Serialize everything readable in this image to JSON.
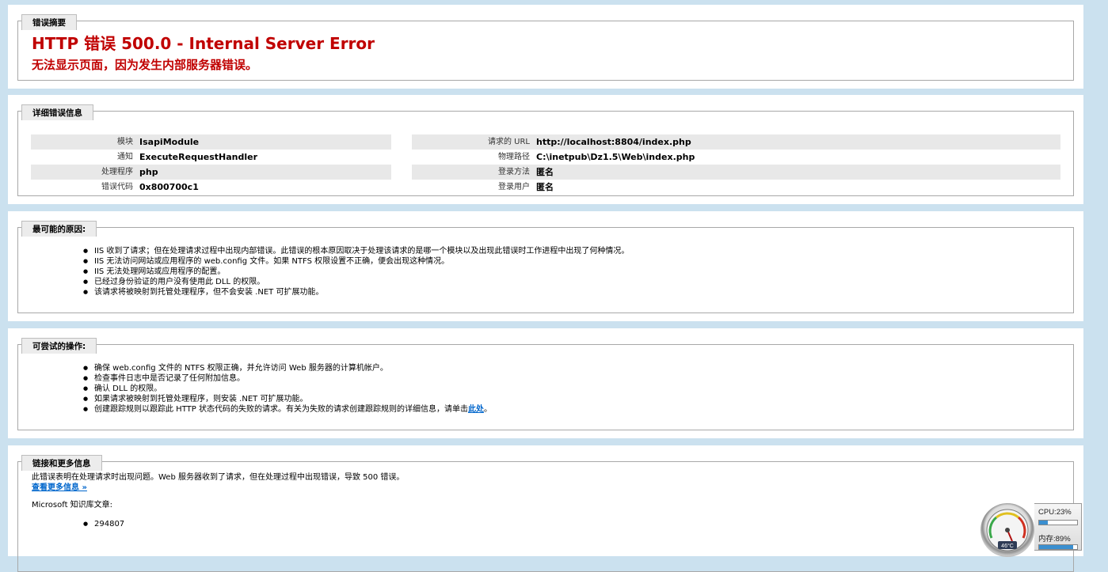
{
  "summary": {
    "legend": "错误摘要",
    "title": "HTTP 错误 500.0 - Internal Server Error",
    "subtitle": "无法显示页面，因为发生内部服务器错误。"
  },
  "details": {
    "legend": "详细错误信息",
    "left": [
      {
        "label": "模块",
        "value": "IsapiModule"
      },
      {
        "label": "通知",
        "value": "ExecuteRequestHandler"
      },
      {
        "label": "处理程序",
        "value": "php"
      },
      {
        "label": "错误代码",
        "value": "0x800700c1"
      }
    ],
    "right": [
      {
        "label": "请求的 URL",
        "value": "http://localhost:8804/index.php"
      },
      {
        "label": "物理路径",
        "value": "C:\\inetpub\\Dz1.5\\Web\\index.php"
      },
      {
        "label": "登录方法",
        "value": "匿名"
      },
      {
        "label": "登录用户",
        "value": "匿名"
      }
    ]
  },
  "causes": {
    "legend": "最可能的原因:",
    "items": [
      "IIS 收到了请求；但在处理请求过程中出现内部错误。此错误的根本原因取决于处理该请求的是哪一个模块以及出现此错误时工作进程中出现了何种情况。",
      "IIS 无法访问网站或应用程序的 web.config 文件。如果 NTFS 权限设置不正确，便会出现这种情况。",
      "IIS 无法处理网站或应用程序的配置。",
      "已经过身份验证的用户没有使用此 DLL 的权限。",
      "该请求将被映射到托管处理程序，但不会安装 .NET 可扩展功能。"
    ]
  },
  "actions": {
    "legend": "可尝试的操作:",
    "items": [
      "确保 web.config 文件的 NTFS 权限正确，并允许访问 Web 服务器的计算机帐户。",
      "检查事件日志中是否记录了任何附加信息。",
      "确认 DLL 的权限。",
      "如果请求被映射到托管处理程序，则安装 .NET 可扩展功能。"
    ],
    "last_item_text": "创建跟踪规则以跟踪此 HTTP 状态代码的失败的请求。有关为失败的请求创建跟踪规则的详细信息，请单击",
    "last_item_link": "此处",
    "last_item_end": "。"
  },
  "links": {
    "legend": "链接和更多信息",
    "description": "此错误表明在处理请求时出现问题。Web 服务器收到了请求，但在处理过程中出现错误，导致 500 错误。",
    "more_link": "查看更多信息 »",
    "kb_label": "Microsoft 知识库文章:",
    "kb_items": [
      "294807"
    ]
  },
  "gadget": {
    "cpu_label": "CPU:23%",
    "cpu_percent": 23,
    "mem_label": "内存:89%",
    "mem_percent": 89,
    "temp": "46°C"
  }
}
